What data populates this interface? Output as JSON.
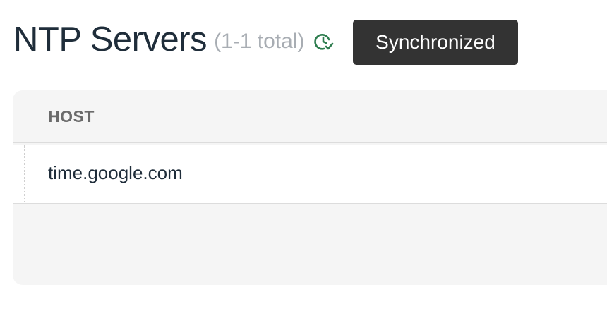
{
  "header": {
    "title": "NTP Servers",
    "count": "(1-1 total)",
    "status_icon": "clock-check-icon",
    "status_color": "#2e7d4f"
  },
  "tooltip": {
    "text": "Synchronized"
  },
  "table": {
    "columns": [
      "HOST"
    ],
    "rows": [
      {
        "host": "time.google.com"
      }
    ]
  }
}
